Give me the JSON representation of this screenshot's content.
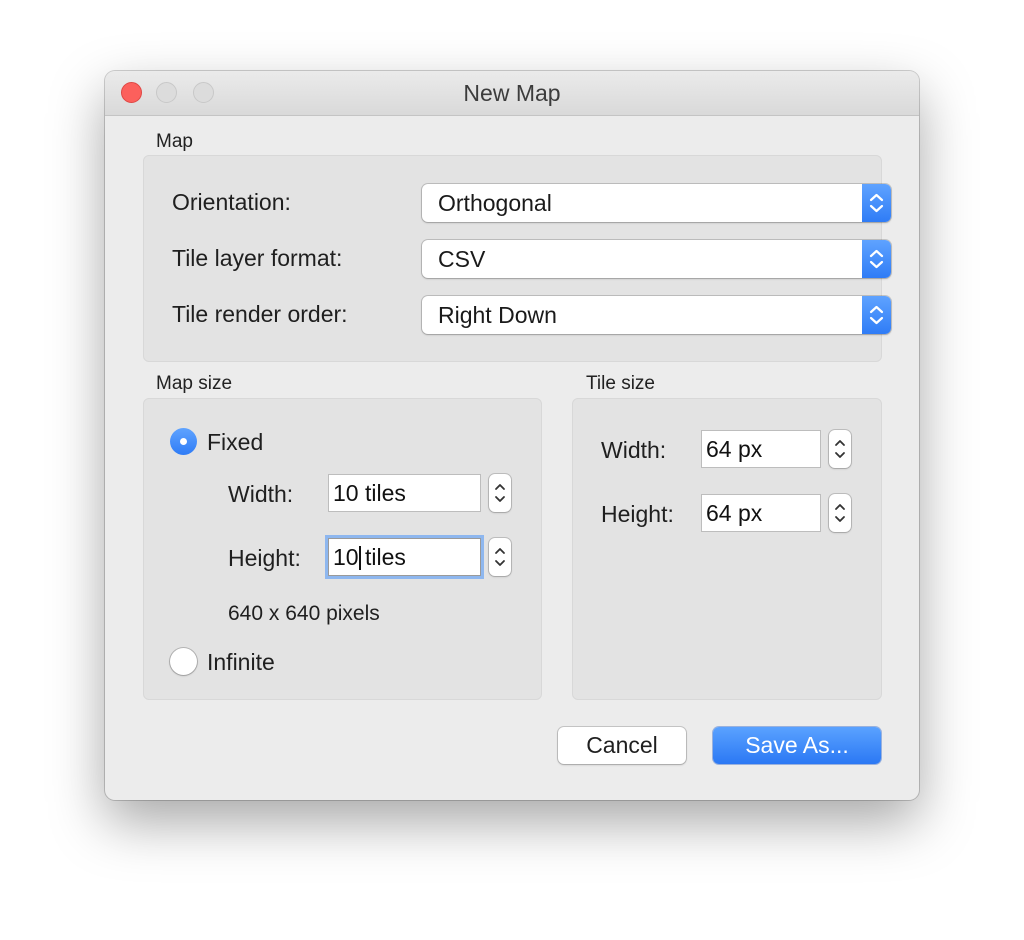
{
  "window": {
    "title": "New Map",
    "traffic_lights": [
      "close",
      "minimize",
      "zoom"
    ]
  },
  "map_group": {
    "label": "Map",
    "orientation": {
      "label": "Orientation:",
      "value": "Orthogonal"
    },
    "layer_format": {
      "label": "Tile layer format:",
      "value": "CSV"
    },
    "render_order": {
      "label": "Tile render order:",
      "value": "Right Down"
    }
  },
  "map_size": {
    "label": "Map size",
    "fixed_label": "Fixed",
    "fixed_selected": true,
    "width": {
      "label": "Width:",
      "value": "10 tiles"
    },
    "height": {
      "label": "Height:",
      "value": "10 tiles",
      "focused": true
    },
    "pixels_text": "640 x 640 pixels",
    "infinite_label": "Infinite",
    "infinite_selected": false
  },
  "tile_size": {
    "label": "Tile size",
    "width": {
      "label": "Width:",
      "value": "64 px"
    },
    "height": {
      "label": "Height:",
      "value": "64 px"
    }
  },
  "buttons": {
    "cancel": "Cancel",
    "save_as": "Save As..."
  },
  "colors": {
    "accent": "#3b87f7",
    "close_button": "#fc605c",
    "window_bg": "#ececec",
    "panel_bg": "#e3e3e3"
  },
  "icons": {
    "select_arrows": "up-down-chevron-icon",
    "stepper": "stepper-arrows-icon"
  }
}
